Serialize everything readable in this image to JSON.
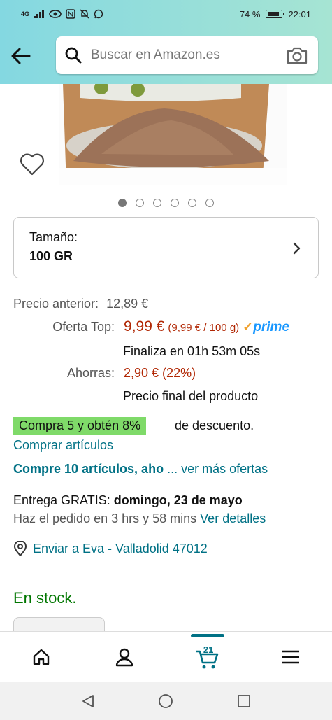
{
  "status_bar": {
    "network": "4G",
    "battery_percent": "74 %",
    "time": "22:01"
  },
  "search": {
    "placeholder": "Buscar en Amazon.es"
  },
  "gallery": {
    "image_count": 6,
    "active_index": 0
  },
  "size": {
    "label": "Tamaño:",
    "value": "100 GR"
  },
  "pricing": {
    "prev_label": "Precio anterior:",
    "prev_value": "12,89 €",
    "offer_label": "Oferta Top:",
    "offer_value": "9,99 €",
    "per_unit": "(9,99 € / 100 g)",
    "prime": "prime",
    "ends_in": "Finaliza en 01h 53m 05s",
    "save_label": "Ahorras:",
    "save_value": "2,90 € (22%)",
    "final_note": "Precio final del producto"
  },
  "promo": {
    "badge": "Compra 5 y obtén 8%",
    "suffix": "de descuento.",
    "buy_items": "Comprar artículos",
    "more_bold": "Compre 10 artículos, aho",
    "more_link": "... ver más ofertas"
  },
  "delivery": {
    "prefix": "Entrega GRATIS:",
    "date": "domingo, 23 de mayo",
    "order_within": "Haz el pedido en 3 hrs y 58 mins",
    "details_link": "Ver detalles",
    "ship_to": "Enviar a Eva - Valladolid 47012"
  },
  "stock": "En stock.",
  "bottom_nav": {
    "cart_count": "21"
  },
  "colors": {
    "header_start": "#84d8e1",
    "header_end": "#a6e4d3",
    "link": "#007185",
    "price_red": "#b12704",
    "promo_green": "#7fda69",
    "stock_green": "#007600"
  }
}
